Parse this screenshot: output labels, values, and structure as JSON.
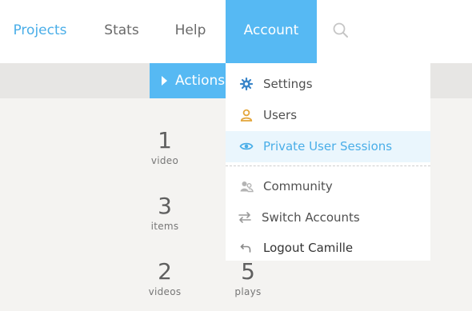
{
  "nav": {
    "projects": "Projects",
    "stats": "Stats",
    "help": "Help",
    "account": "Account",
    "search_icon": "search-icon"
  },
  "actions": {
    "label": "Actions"
  },
  "stats": [
    {
      "number": "1",
      "unit": "video"
    },
    {
      "number": "3",
      "unit": "items"
    },
    {
      "number": "2",
      "unit": "videos"
    },
    {
      "number": "5",
      "unit": "plays"
    }
  ],
  "account_menu": {
    "items": [
      {
        "label": "Settings",
        "icon": "gear-icon",
        "color": "#3b86c9"
      },
      {
        "label": "Users",
        "icon": "user-icon",
        "color": "#e3a53a"
      },
      {
        "label": "Private User Sessions",
        "icon": "eye-icon",
        "color": "#4aaee8",
        "highlighted": true
      },
      {
        "label": "Community",
        "icon": "community-icon",
        "color": "#aaaaaa"
      },
      {
        "label": "Switch Accounts",
        "icon": "swap-icon",
        "color": "#999999"
      },
      {
        "label": "Logout Camille",
        "icon": "logout-icon",
        "color": "#888888"
      }
    ]
  },
  "colors": {
    "accent": "#56b9f3",
    "link": "#4aaee8"
  }
}
